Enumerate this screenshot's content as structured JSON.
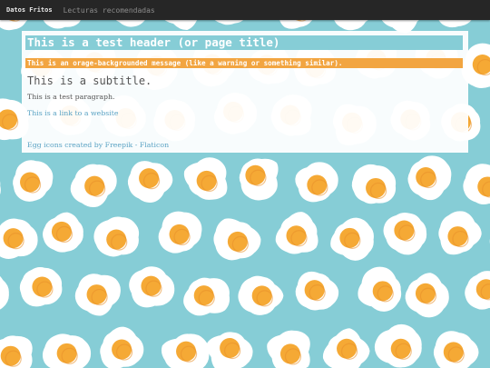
{
  "nav": {
    "brand": "Datos Fritos",
    "links": [
      "Lecturas recomendadas"
    ]
  },
  "content": {
    "title": "This is a test header (or page title)",
    "warning": "This is an orage-backgrounded message (like a warning or something similar).",
    "subtitle": "This is a subtitle.",
    "paragraph": "This is a test paragraph.",
    "link_text": "This is a link to a website",
    "credit": {
      "prefix": "Egg icons created by ",
      "author": "Freepik",
      "separator": " - ",
      "site": "Flaticon"
    }
  },
  "colors": {
    "background": "#86cdd6",
    "navbar": "#262626",
    "accent": "#86cdd6",
    "warning": "#f2a541",
    "link": "#5ba3c4",
    "egg_white": "#ffffff",
    "egg_yolk": "#f5a935"
  },
  "icons": [
    "fried-egg-icon"
  ]
}
